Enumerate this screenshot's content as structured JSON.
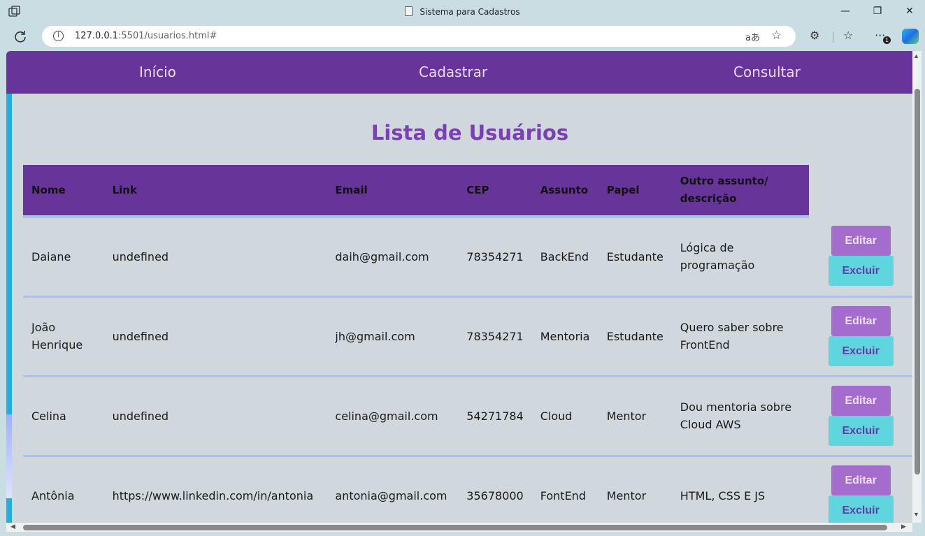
{
  "browser": {
    "window_title": "Sistema para Cadastros",
    "url_host": "127.0.0.1",
    "url_rest": ":5501/usuarios.html#",
    "minimize": "—",
    "maximize": "❐",
    "close": "✕"
  },
  "nav": {
    "items": [
      "Início",
      "Cadastrar",
      "Consultar"
    ]
  },
  "page": {
    "title": "Lista de Usuários"
  },
  "table": {
    "headers": [
      "Nome",
      "Link",
      "Email",
      "CEP",
      "Assunto",
      "Papel",
      "Outro assunto/ descrição"
    ],
    "rows": [
      [
        "Daiane",
        "undefined",
        "daih@gmail.com",
        "78354271",
        "BackEnd",
        "Estudante",
        "Lógica de programação"
      ],
      [
        "João Henrique",
        "undefined",
        "jh@gmail.com",
        "78354271",
        "Mentoria",
        "Estudante",
        "Quero saber sobre FrontEnd"
      ],
      [
        "Celina",
        "undefined",
        "celina@gmail.com",
        "54271784",
        "Cloud",
        "Mentor",
        "Dou mentoria sobre Cloud AWS"
      ],
      [
        "Antônia",
        "https://www.linkedin.com/in/antonia",
        "antonia@gmail.com",
        "35678000",
        "FontEnd",
        "Mentor",
        "HTML, CSS E JS"
      ]
    ],
    "edit_label": "Editar",
    "delete_label": "Excluir"
  },
  "colors": {
    "nav_bg": "#673499",
    "title": "#7a3fb2",
    "edit_button": "#a46ccd",
    "delete_button": "#5fd6de"
  }
}
